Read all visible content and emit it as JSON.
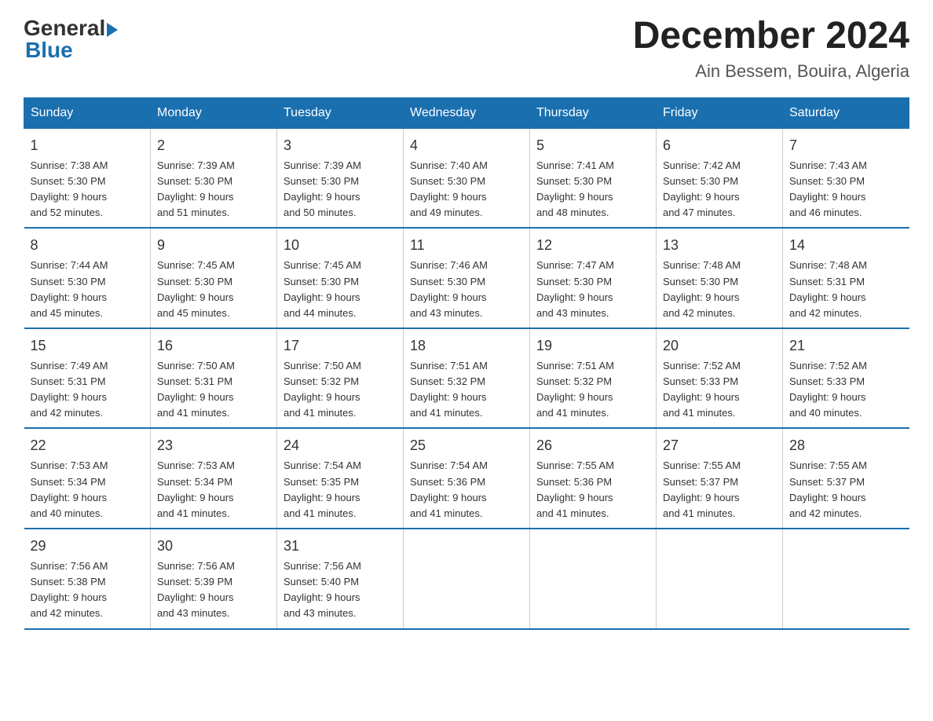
{
  "logo": {
    "line1": "General",
    "arrow": "►",
    "line2": "Blue"
  },
  "title": "December 2024",
  "subtitle": "Ain Bessem, Bouira, Algeria",
  "days_header": [
    "Sunday",
    "Monday",
    "Tuesday",
    "Wednesday",
    "Thursday",
    "Friday",
    "Saturday"
  ],
  "weeks": [
    [
      {
        "num": "1",
        "sunrise": "7:38 AM",
        "sunset": "5:30 PM",
        "daylight": "9 hours and 52 minutes."
      },
      {
        "num": "2",
        "sunrise": "7:39 AM",
        "sunset": "5:30 PM",
        "daylight": "9 hours and 51 minutes."
      },
      {
        "num": "3",
        "sunrise": "7:39 AM",
        "sunset": "5:30 PM",
        "daylight": "9 hours and 50 minutes."
      },
      {
        "num": "4",
        "sunrise": "7:40 AM",
        "sunset": "5:30 PM",
        "daylight": "9 hours and 49 minutes."
      },
      {
        "num": "5",
        "sunrise": "7:41 AM",
        "sunset": "5:30 PM",
        "daylight": "9 hours and 48 minutes."
      },
      {
        "num": "6",
        "sunrise": "7:42 AM",
        "sunset": "5:30 PM",
        "daylight": "9 hours and 47 minutes."
      },
      {
        "num": "7",
        "sunrise": "7:43 AM",
        "sunset": "5:30 PM",
        "daylight": "9 hours and 46 minutes."
      }
    ],
    [
      {
        "num": "8",
        "sunrise": "7:44 AM",
        "sunset": "5:30 PM",
        "daylight": "9 hours and 45 minutes."
      },
      {
        "num": "9",
        "sunrise": "7:45 AM",
        "sunset": "5:30 PM",
        "daylight": "9 hours and 45 minutes."
      },
      {
        "num": "10",
        "sunrise": "7:45 AM",
        "sunset": "5:30 PM",
        "daylight": "9 hours and 44 minutes."
      },
      {
        "num": "11",
        "sunrise": "7:46 AM",
        "sunset": "5:30 PM",
        "daylight": "9 hours and 43 minutes."
      },
      {
        "num": "12",
        "sunrise": "7:47 AM",
        "sunset": "5:30 PM",
        "daylight": "9 hours and 43 minutes."
      },
      {
        "num": "13",
        "sunrise": "7:48 AM",
        "sunset": "5:30 PM",
        "daylight": "9 hours and 42 minutes."
      },
      {
        "num": "14",
        "sunrise": "7:48 AM",
        "sunset": "5:31 PM",
        "daylight": "9 hours and 42 minutes."
      }
    ],
    [
      {
        "num": "15",
        "sunrise": "7:49 AM",
        "sunset": "5:31 PM",
        "daylight": "9 hours and 42 minutes."
      },
      {
        "num": "16",
        "sunrise": "7:50 AM",
        "sunset": "5:31 PM",
        "daylight": "9 hours and 41 minutes."
      },
      {
        "num": "17",
        "sunrise": "7:50 AM",
        "sunset": "5:32 PM",
        "daylight": "9 hours and 41 minutes."
      },
      {
        "num": "18",
        "sunrise": "7:51 AM",
        "sunset": "5:32 PM",
        "daylight": "9 hours and 41 minutes."
      },
      {
        "num": "19",
        "sunrise": "7:51 AM",
        "sunset": "5:32 PM",
        "daylight": "9 hours and 41 minutes."
      },
      {
        "num": "20",
        "sunrise": "7:52 AM",
        "sunset": "5:33 PM",
        "daylight": "9 hours and 41 minutes."
      },
      {
        "num": "21",
        "sunrise": "7:52 AM",
        "sunset": "5:33 PM",
        "daylight": "9 hours and 40 minutes."
      }
    ],
    [
      {
        "num": "22",
        "sunrise": "7:53 AM",
        "sunset": "5:34 PM",
        "daylight": "9 hours and 40 minutes."
      },
      {
        "num": "23",
        "sunrise": "7:53 AM",
        "sunset": "5:34 PM",
        "daylight": "9 hours and 41 minutes."
      },
      {
        "num": "24",
        "sunrise": "7:54 AM",
        "sunset": "5:35 PM",
        "daylight": "9 hours and 41 minutes."
      },
      {
        "num": "25",
        "sunrise": "7:54 AM",
        "sunset": "5:36 PM",
        "daylight": "9 hours and 41 minutes."
      },
      {
        "num": "26",
        "sunrise": "7:55 AM",
        "sunset": "5:36 PM",
        "daylight": "9 hours and 41 minutes."
      },
      {
        "num": "27",
        "sunrise": "7:55 AM",
        "sunset": "5:37 PM",
        "daylight": "9 hours and 41 minutes."
      },
      {
        "num": "28",
        "sunrise": "7:55 AM",
        "sunset": "5:37 PM",
        "daylight": "9 hours and 42 minutes."
      }
    ],
    [
      {
        "num": "29",
        "sunrise": "7:56 AM",
        "sunset": "5:38 PM",
        "daylight": "9 hours and 42 minutes."
      },
      {
        "num": "30",
        "sunrise": "7:56 AM",
        "sunset": "5:39 PM",
        "daylight": "9 hours and 43 minutes."
      },
      {
        "num": "31",
        "sunrise": "7:56 AM",
        "sunset": "5:40 PM",
        "daylight": "9 hours and 43 minutes."
      },
      null,
      null,
      null,
      null
    ]
  ],
  "labels": {
    "sunrise": "Sunrise: ",
    "sunset": "Sunset: ",
    "daylight": "Daylight: "
  },
  "colors": {
    "header_bg": "#1a6faf",
    "header_text": "#ffffff",
    "border": "#1a6faf",
    "body_bg": "#ffffff"
  }
}
